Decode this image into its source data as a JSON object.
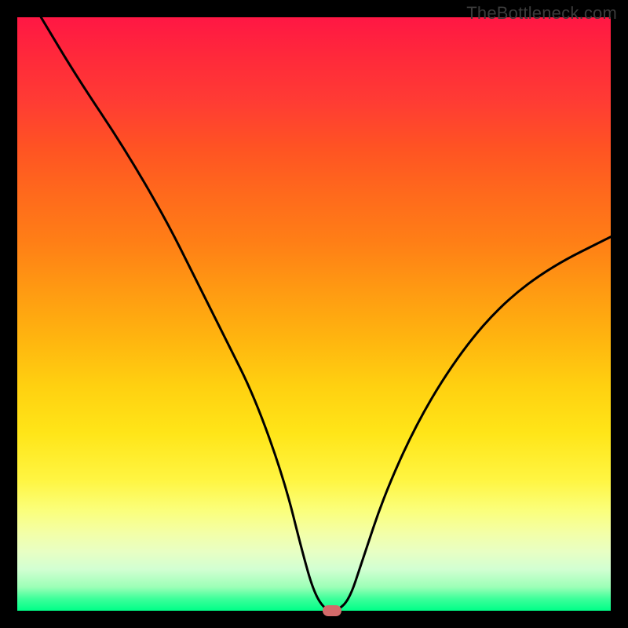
{
  "watermark": "TheBottleneck.com",
  "chart_data": {
    "type": "line",
    "title": "",
    "xlabel": "",
    "ylabel": "",
    "xlim": [
      0,
      100
    ],
    "ylim": [
      0,
      100
    ],
    "curve": {
      "x": [
        4,
        10,
        18,
        25,
        30,
        35,
        40,
        45,
        48,
        50,
        52,
        54,
        56,
        58,
        62,
        68,
        75,
        82,
        90,
        100
      ],
      "y": [
        100,
        90,
        78,
        66,
        56,
        46,
        36,
        22,
        10,
        3,
        0,
        0,
        2,
        8,
        20,
        33,
        44,
        52,
        58,
        63
      ]
    },
    "optimum_marker": {
      "x": 53,
      "y": 0
    },
    "gradient_stops": [
      {
        "pct": 0,
        "color": "#ff1744"
      },
      {
        "pct": 50,
        "color": "#ffd010"
      },
      {
        "pct": 85,
        "color": "#f6ffb0"
      },
      {
        "pct": 100,
        "color": "#00ff88"
      }
    ]
  }
}
